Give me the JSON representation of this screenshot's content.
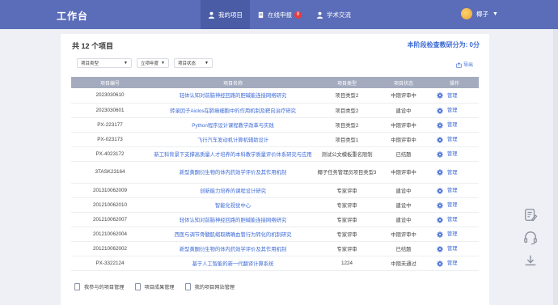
{
  "header": {
    "brand": "工作台",
    "nav": [
      {
        "label": "我的项目",
        "icon": "user-icon",
        "active": true
      },
      {
        "label": "在线申报",
        "icon": "document-icon",
        "badge": "8"
      },
      {
        "label": "学术交流",
        "icon": "user-icon"
      }
    ],
    "user_name": "椰子"
  },
  "summary": {
    "count_title": "共 12 个项目",
    "score_label": "本阶段检查教研分为:",
    "score_value": "0分"
  },
  "filters": [
    {
      "label": "项目类型"
    },
    {
      "label": "立项年度"
    },
    {
      "label": "项目状态"
    }
  ],
  "export_label": "导出",
  "table": {
    "columns": [
      "项目编号",
      "项目名称",
      "项目类型",
      "项目状态",
      "操作"
    ],
    "rows": [
      {
        "id": "2023030610",
        "name": "轻体认知对前脑神经回路的胆碱能连接网络研究",
        "type": "项目类型2",
        "status": "中期评审中",
        "op": "管理"
      },
      {
        "id": "2023030601",
        "name": "转录因子Aiolos在肺癌细胞中的作用机制及靶向治疗研究",
        "type": "项目类型2",
        "status": "建设中",
        "op": "管理"
      },
      {
        "id": "PX-223177",
        "name": "Python程序设计课程教学改革与实践",
        "type": "项目类型2",
        "status": "中期评审中",
        "op": "管理"
      },
      {
        "id": "PX-023173",
        "name": "飞行汽车发动机计算机辅助设计",
        "type": "项目类型1",
        "status": "中期评审中",
        "op": "管理"
      },
      {
        "id": "PX-4023172",
        "name": "新工科背景下支撑高质量人才培养的本科教学质量评价体系研究与应用",
        "type": "测试公文模板重名限制",
        "status": "已结题",
        "op": "管理"
      },
      {
        "id": "3TASK23164",
        "name": "新型黄酮衍生物的体内药效学评价及其作用机制",
        "type": "椰子任务管理员项目类型3",
        "status": "中期评审中",
        "op": "管理",
        "tall": true
      },
      {
        "id": "201310062009",
        "name": "创新能力培养的课程设计研究",
        "type": "专家评审",
        "status": "建设中",
        "op": "管理"
      },
      {
        "id": "201210062010",
        "name": "智能化视觉中心",
        "type": "专家评审",
        "status": "建设中",
        "op": "管理"
      },
      {
        "id": "201210062007",
        "name": "轻体认知对前脑神经回路的胆碱能连接网络研究",
        "type": "专家评审",
        "status": "建设中",
        "op": "管理"
      },
      {
        "id": "201210062004",
        "name": "西医与调节骨髓肌缩取精确血管行为转化的机制研究",
        "type": "专家评审",
        "status": "中期评审中",
        "op": "管理"
      },
      {
        "id": "201210062002",
        "name": "新型黄酮衍生物的体内药效学评价及其作用机制",
        "type": "专家评审",
        "status": "已结题",
        "op": "管理"
      },
      {
        "id": "PX-3322124",
        "name": "基于人工智能的新一代翻译计算系统",
        "type": "1224",
        "status": "中期未通过",
        "op": "管理"
      }
    ]
  },
  "footer_links": [
    {
      "label": "我参与的项目管理"
    },
    {
      "label": "项目成果管理"
    },
    {
      "label": "我的项目网站管理"
    }
  ],
  "side_tools": [
    {
      "icon": "edit-note-icon"
    },
    {
      "icon": "headset-icon"
    },
    {
      "icon": "download-icon"
    }
  ],
  "colors": {
    "topbar": "#5b6db8",
    "accent": "#3d6ad6",
    "table_header": "#a4abbf"
  }
}
